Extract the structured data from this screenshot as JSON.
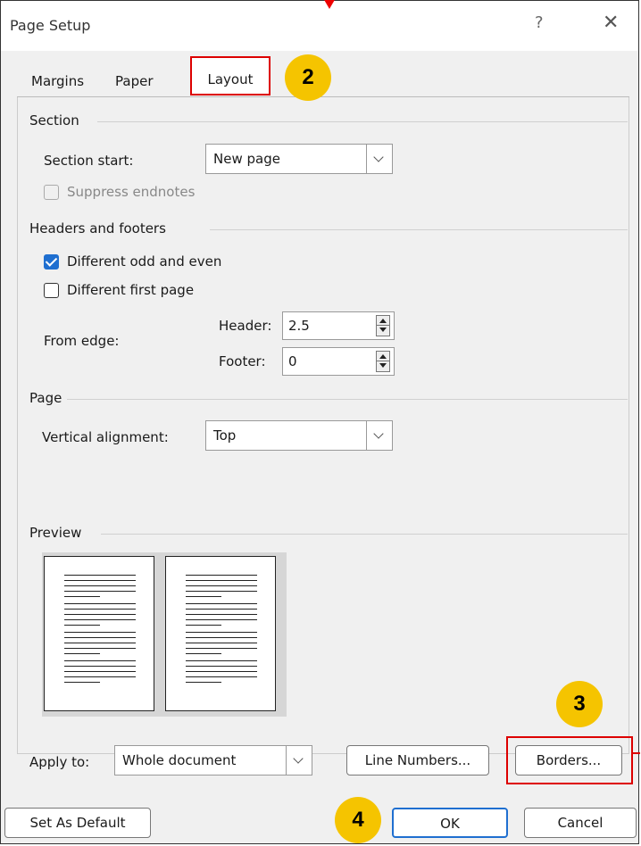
{
  "title": "Page Setup",
  "help_glyph": "?",
  "close_glyph": "✕",
  "tabs": [
    "Margins",
    "Paper",
    "Layout"
  ],
  "badges": {
    "b2": "2",
    "b3": "3",
    "b4": "4"
  },
  "section": {
    "heading": "Section",
    "start_label": "Section start:",
    "start_value": "New page",
    "suppress_label": "Suppress endnotes",
    "suppress_checked": false
  },
  "headers": {
    "heading": "Headers and footers",
    "odd_even_label": "Different odd and even",
    "odd_even_checked": true,
    "first_page_label": "Different first page",
    "first_page_checked": false,
    "from_edge_label": "From edge:",
    "header_label": "Header:",
    "header_value": "2.5",
    "footer_label": "Footer:",
    "footer_value": "0"
  },
  "page": {
    "heading": "Page",
    "valign_label": "Vertical alignment:",
    "valign_value": "Top"
  },
  "preview": {
    "heading": "Preview"
  },
  "apply": {
    "label": "Apply to:",
    "value": "Whole document"
  },
  "buttons": {
    "line_numbers": "Line Numbers...",
    "borders": "Borders...",
    "set_default": "Set As Default",
    "ok": "OK",
    "cancel": "Cancel"
  },
  "colors": {
    "accent": "#1f6fd0",
    "highlight": "#d00000",
    "badge": "#f5c400"
  }
}
